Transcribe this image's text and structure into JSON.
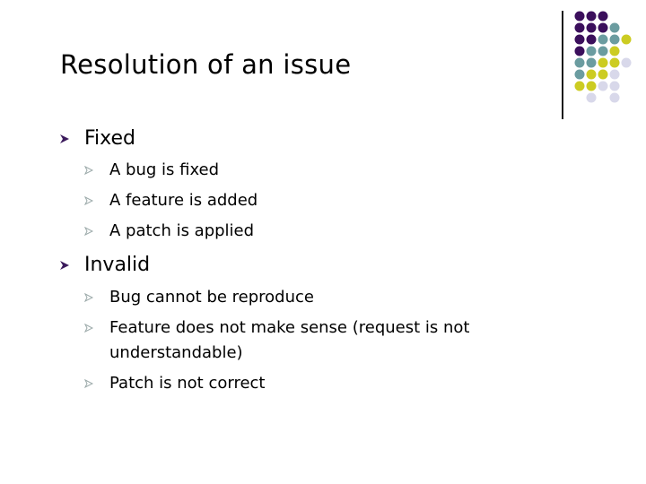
{
  "slide": {
    "title": "Resolution of an issue",
    "bullets": [
      {
        "label": "Fixed",
        "children": [
          {
            "label": "A bug is fixed"
          },
          {
            "label": "A feature is added"
          },
          {
            "label": "A patch is applied"
          }
        ]
      },
      {
        "label": "Invalid",
        "children": [
          {
            "label": "Bug cannot be reproduce"
          },
          {
            "label": "Feature does not make sense (request is not",
            "continuation": "understandable)"
          },
          {
            "label": "Patch is not correct"
          }
        ]
      }
    ]
  },
  "icons": {
    "level1_bullet": "arrowhead-bullet-icon",
    "level2_bullet": "arrowhead-bullet-icon"
  },
  "colors": {
    "purple": "#3b0f5c",
    "teal": "#6b9ca0",
    "yellow": "#cccc22",
    "lavender": "#d8d8ea",
    "bullet1": "#3b1a5c",
    "bullet2": "#9aa8a8"
  },
  "decoration": {
    "dot_grid": [
      [
        "P",
        "P",
        "P",
        "",
        ""
      ],
      [
        "P",
        "P",
        "P",
        "T",
        ""
      ],
      [
        "P",
        "P",
        "T",
        "T",
        "Y"
      ],
      [
        "P",
        "T",
        "T",
        "Y",
        ""
      ],
      [
        "T",
        "T",
        "Y",
        "Y",
        "L"
      ],
      [
        "T",
        "Y",
        "Y",
        "L",
        ""
      ],
      [
        "Y",
        "Y",
        "L",
        "L",
        ""
      ],
      [
        "",
        "L",
        "",
        "L",
        ""
      ]
    ]
  }
}
